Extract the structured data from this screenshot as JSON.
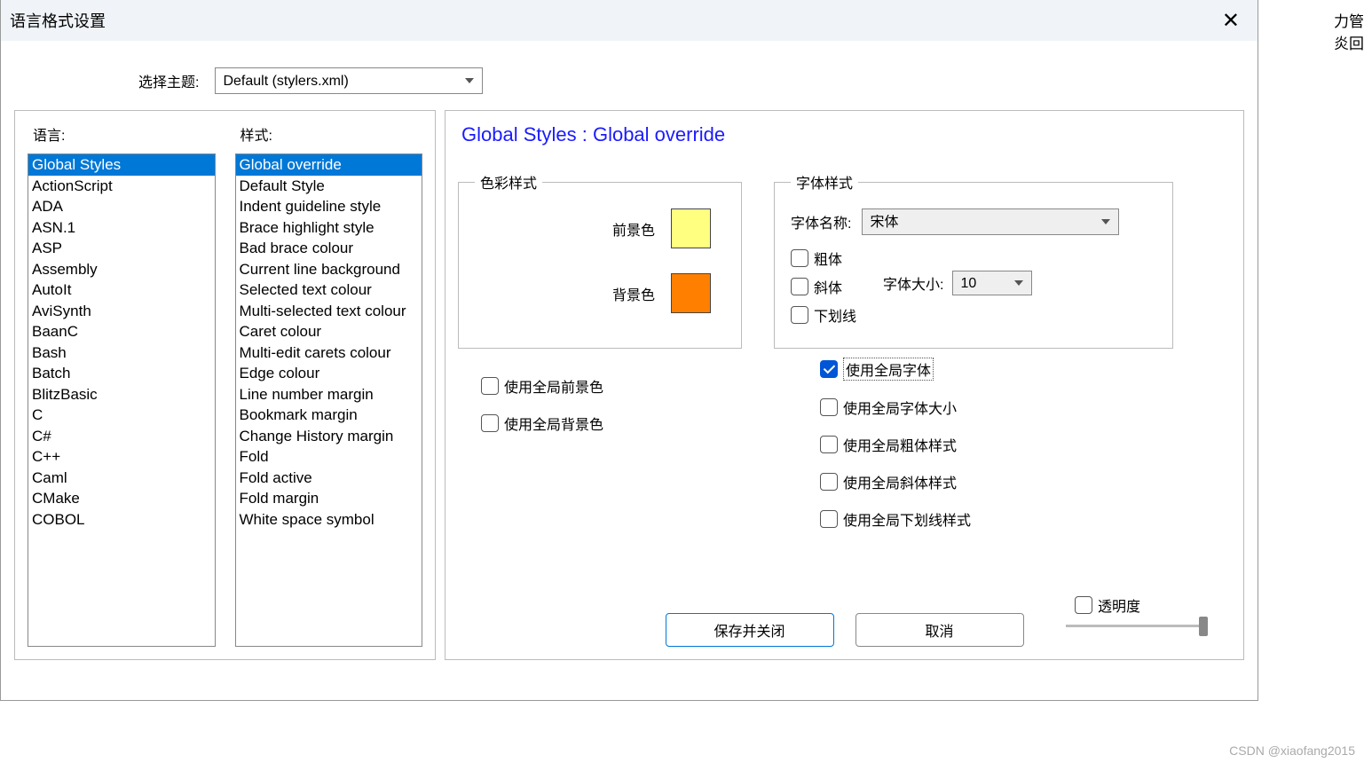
{
  "dialog": {
    "title": "语言格式设置",
    "theme_label": "选择主题:",
    "theme_value": "Default (stylers.xml)"
  },
  "lists": {
    "lang_label": "语言:",
    "style_label": "样式:",
    "languages": [
      "Global Styles",
      "ActionScript",
      "ADA",
      "ASN.1",
      "ASP",
      "Assembly",
      "AutoIt",
      "AviSynth",
      "BaanC",
      "Bash",
      "Batch",
      "BlitzBasic",
      "C",
      "C#",
      "C++",
      "Caml",
      "CMake",
      "COBOL"
    ],
    "styles": [
      "Global override",
      "Default Style",
      "Indent guideline style",
      "Brace highlight style",
      "Bad brace colour",
      "Current line background",
      "Selected text colour",
      "Multi-selected text colour",
      "Caret colour",
      "Multi-edit carets colour",
      "Edge colour",
      "Line number margin",
      "Bookmark margin",
      "Change History margin",
      "Fold",
      "Fold active",
      "Fold margin",
      "White space symbol"
    ]
  },
  "detail": {
    "header": "Global Styles : Global override",
    "color_legend": "色彩样式",
    "font_legend": "字体样式",
    "fg_label": "前景色",
    "bg_label": "背景色",
    "font_name_label": "字体名称:",
    "font_name_value": "宋体",
    "font_size_label": "字体大小:",
    "font_size_value": "10",
    "bold_label": "粗体",
    "italic_label": "斜体",
    "underline_label": "下划线",
    "use_global_fg": "使用全局前景色",
    "use_global_bg": "使用全局背景色",
    "use_global_font": "使用全局字体",
    "use_global_font_size": "使用全局字体大小",
    "use_global_bold": "使用全局粗体样式",
    "use_global_italic": "使用全局斜体样式",
    "use_global_underline": "使用全局下划线样式"
  },
  "footer": {
    "save_close": "保存并关闭",
    "cancel": "取消",
    "transparency": "透明度"
  },
  "bg": {
    "t1": "力管",
    "t2": "炎回"
  },
  "watermark": "CSDN @xiaofang2015"
}
